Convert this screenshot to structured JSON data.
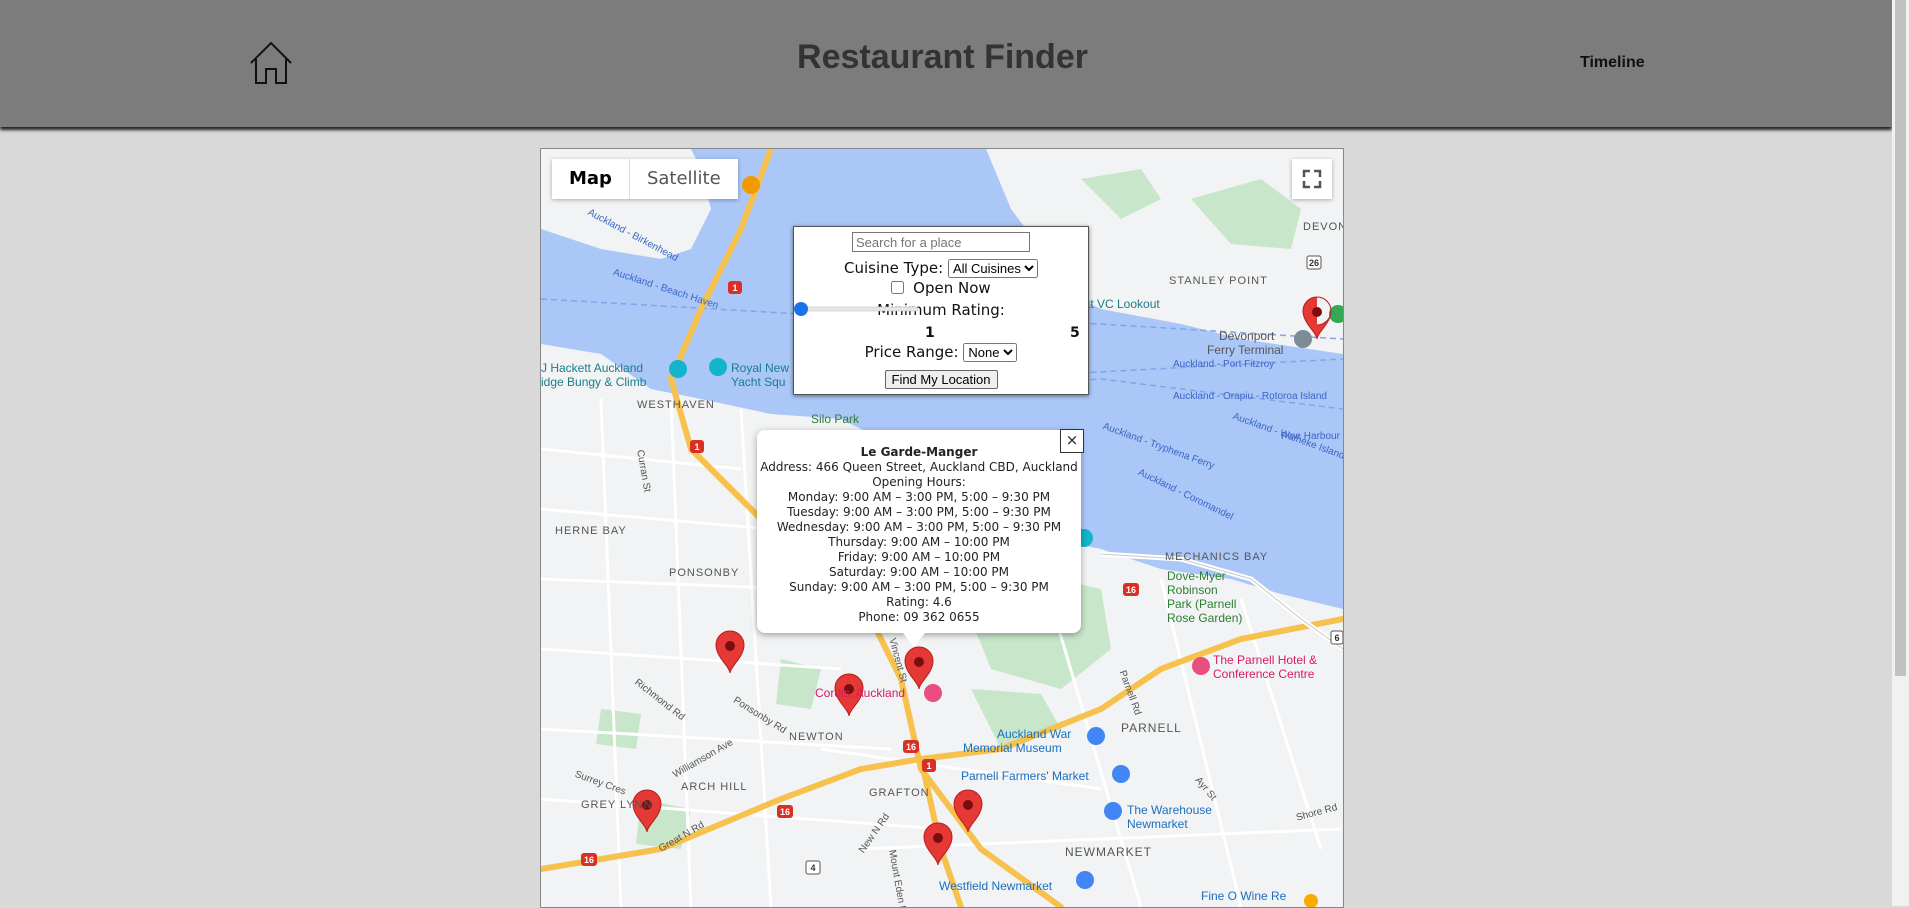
{
  "header": {
    "title": "Restaurant Finder",
    "timeline_label": "Timeline",
    "home_icon": "home-icon"
  },
  "map_controls": {
    "map_label": "Map",
    "satellite_label": "Satellite",
    "active": "Map",
    "fullscreen_icon": "fullscreen-icon"
  },
  "filters": {
    "search_placeholder": "Search for a place",
    "cuisine_label": "Cuisine Type:",
    "cuisine_value": "All Cuisines",
    "open_now_label": "Open Now",
    "open_now_checked": false,
    "rating_label": "Minimum Rating:",
    "rating_min": "1",
    "rating_max": "5",
    "rating_value": 1,
    "price_label": "Price Range:",
    "price_value": "None",
    "locate_label": "Find My Location"
  },
  "info_window": {
    "name": "Le Garde-Manger",
    "address": "Address: 466 Queen Street, Auckland CBD, Auckland",
    "hours_label": "Opening Hours:",
    "hours": [
      "Monday: 9:00 AM – 3:00 PM, 5:00 – 9:30 PM",
      "Tuesday: 9:00 AM – 3:00 PM, 5:00 – 9:30 PM",
      "Wednesday: 9:00 AM – 3:00 PM, 5:00 – 9:30 PM",
      "Thursday: 9:00 AM – 10:00 PM",
      "Friday: 9:00 AM – 10:00 PM",
      "Saturday: 9:00 AM – 10:00 PM",
      "Sunday: 9:00 AM – 3:00 PM, 5:00 – 9:30 PM"
    ],
    "rating": "Rating: 4.6",
    "phone": "Phone: 09 362 0655",
    "close_symbol": "×"
  },
  "map_labels": {
    "devonport": "DEVON",
    "stanley_point": "STANLEY POINT",
    "devonport_ferry": "Devonport",
    "ferry_terminal": "Ferry Terminal",
    "vc_lookout": "tt VC Lookout",
    "hackett": "J Hackett Auckland",
    "bungy": "idge Bungy & Climb",
    "royal": "Royal New",
    "yacht": "Yacht Squ",
    "westhaven": "WESTHAVEN",
    "silo_park": "Silo Park",
    "herne_bay": "HERNE BAY",
    "ponsonby": "PONSONBY",
    "mechanics_bay": "MECHANICS BAY",
    "dove_myer_1": "Dove-Myer",
    "dove_myer_2": "Robinson",
    "dove_myer_3": "Park (Parnell",
    "dove_myer_4": "Rose Garden)",
    "parnell_hotel_1": "The Parnell Hotel &",
    "parnell_hotel_2": "Conference Centre",
    "cordis": "Cordis, Auckland",
    "newton": "NEWTON",
    "parnell": "PARNELL",
    "museum_1": "Auckland War",
    "museum_2": "Memorial Museum",
    "farmers_market": "Parnell Farmers' Market",
    "arch_hill": "ARCH HILL",
    "grey_lynn": "GREY LYNN",
    "grafton": "GRAFTON",
    "newmarket": "NEWMARKET",
    "warehouse_1": "The Warehouse",
    "warehouse_2": "Newmarket",
    "westfield": "Westfield Newmarket",
    "fine_o_wine": "Fine O Wine Re",
    "birkenhead": "Auckland - Birkenhead",
    "beach_haven": "Auckland - Beach Haven",
    "port_fitzroy": "Auckland - Port Fitzroy",
    "orapiu": "Auckland - Orapiu - Rotoroa Island",
    "tryphena": "Auckland - Tryphena Ferry",
    "waiheke": "Auckland - Waiheke Island",
    "coromandel": "Auckland - Coromandel",
    "pine_harbour": "Pine Harbour -",
    "curran_st": "Curran St",
    "richmond_rd": "Richmond Rd",
    "ponsonby_rd": "Ponsonby Rd",
    "williamson_ave": "Williamson Ave",
    "surrey_cres": "Surrey Cres",
    "great_n_rd": "Great N Rd",
    "new_n_rd": "New N Rd",
    "mt_eden_rd": "Mount Eden Rd",
    "parnell_rd": "Parnell Rd",
    "ayr_st": "Ayr St",
    "shore_rd": "Shore Rd",
    "vincent_st": "Vincent St",
    "dominion_rd": "Rd",
    "r1": "1",
    "r16": "16",
    "r4": "4",
    "r26": "26",
    "r6": "6"
  },
  "colors": {
    "water": "#aac7f8",
    "land": "#f1f3f4",
    "park": "#c8e6c9",
    "highway": "#f6c24d",
    "marker": "#e53935"
  }
}
